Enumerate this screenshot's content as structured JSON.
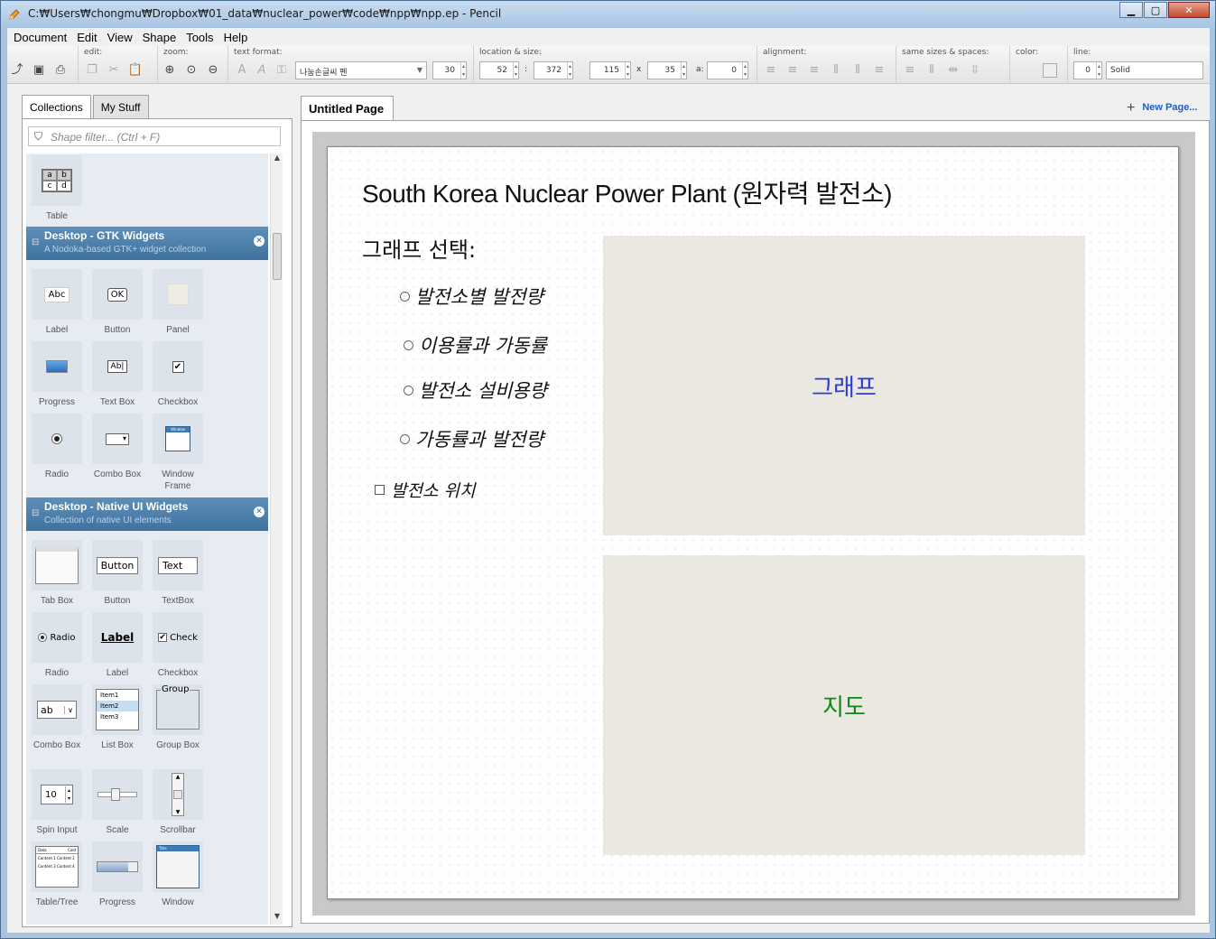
{
  "window": {
    "title": "C:₩Users₩chongmu₩Dropbox₩01_data₩nuclear_power₩code₩npp₩npp.ep - Pencil",
    "buttons": [
      "minimize",
      "maximize",
      "close"
    ]
  },
  "menu": [
    {
      "label": "Document"
    },
    {
      "label": "Edit"
    },
    {
      "label": "View"
    },
    {
      "label": "Shape"
    },
    {
      "label": "Tools"
    },
    {
      "label": "Help"
    }
  ],
  "toolbar": {
    "edit_label": "edit:",
    "zoom_label": "zoom:",
    "text_format_label": "text format:",
    "font_family": "나눔손글씨 펜",
    "font_size": "30",
    "location_label": "location & size:",
    "x": "52",
    "y": "372",
    "width": "115",
    "height": "35",
    "angle_label": "a:",
    "angle": "0",
    "alignment_label": "alignment:",
    "same_sizes_label": "same sizes & spaces:",
    "color_label": "color:",
    "line_label": "line:",
    "line_width": "0",
    "line_style": "Solid"
  },
  "left_panel": {
    "tabs": [
      "Collections",
      "My Stuff"
    ],
    "filter_placeholder": "Shape filter... (Ctrl + F)",
    "top_shape": {
      "label": "Table",
      "cells": [
        "a",
        "b",
        "c",
        "d"
      ]
    },
    "collections": [
      {
        "title": "Desktop - GTK Widgets",
        "subtitle": "A Nodoka-based GTK+ widget collection",
        "shapes": [
          "Label",
          "Button",
          "Panel",
          "Progress",
          "Text Box",
          "Checkbox",
          "Radio",
          "Combo Box",
          "Window Frame"
        ],
        "thumb_text": {
          "label": "Abc",
          "button": "OK",
          "textbox": "Ab|",
          "window": "Window"
        }
      },
      {
        "title": "Desktop - Native UI Widgets",
        "subtitle": "Collection of native UI elements",
        "shapes": [
          "Tab Box",
          "Button",
          "TextBox",
          "Radio",
          "Label",
          "Checkbox",
          "Combo Box",
          "List Box",
          "Group Box",
          "Spin Input",
          "Scale",
          "Scrollbar",
          "Table/Tree",
          "Progress",
          "Window"
        ],
        "thumb_text": {
          "button": "Button",
          "textbox": "Text",
          "radio": "Radio",
          "label": "Label",
          "checkbox": "Check",
          "combo": "ab",
          "list": [
            "Item1",
            "Item2",
            "Item3"
          ],
          "group": "Group",
          "spin": "10",
          "table_headers": [
            "Data",
            "Cold"
          ],
          "table_rows": [
            "Content 1   Content 2",
            "Content 3   Content 4"
          ],
          "window_title": "Title"
        }
      }
    ]
  },
  "page": {
    "tab_label": "Untitled Page",
    "new_page": "New Page..."
  },
  "mockup": {
    "title": "South Korea Nuclear Power Plant (원자력 발전소)",
    "subtitle": "그래프 선택:",
    "radio_options": [
      "발전소별 발전량",
      "이용률과 가동률",
      "발전소 설비용량",
      "가동률과 발전량"
    ],
    "checkbox_label": "발전소 위치",
    "graph_label": "그래프",
    "map_label": "지도",
    "colors": {
      "graph_text": "#2d3ad6",
      "map_text": "#0c8a14",
      "panel_bg": "#ebe8e2"
    }
  }
}
